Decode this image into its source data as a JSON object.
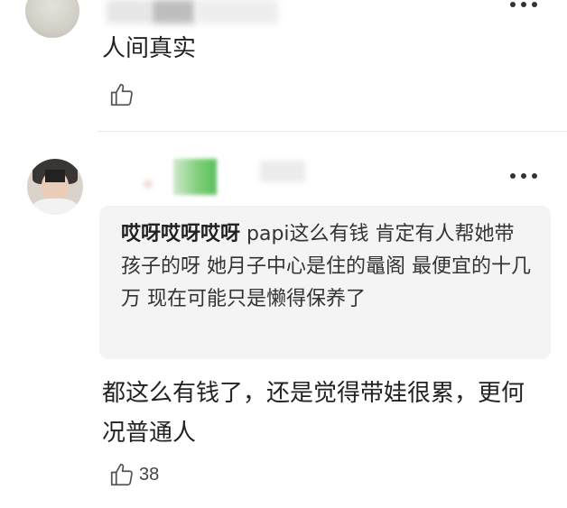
{
  "comments": [
    {
      "text": "人间真实",
      "likes": ""
    },
    {
      "quote": {
        "author": "哎呀哎呀哎呀",
        "text": "papi这么有钱 肯定有人帮她带孩子的呀 她月子中心是住的鼂阁 最便宜的十几万 现在可能只是懒得保养了"
      },
      "text": "都这么有钱了，还是觉得带娃很累，更何况普通人",
      "likes": "38"
    }
  ],
  "icons": {
    "like": "thumbs-up-icon",
    "more": "more-dots-icon"
  },
  "colors": {
    "quote_background": "#f4f4f4",
    "text": "#222222"
  }
}
